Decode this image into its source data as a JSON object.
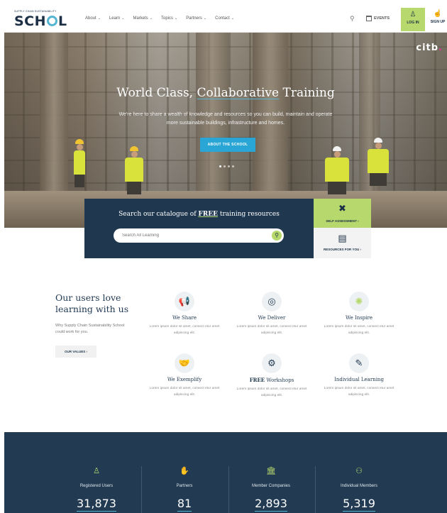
{
  "nav": {
    "logo_tagline": "SUPPLY CHAIN SUSTAINABILITY",
    "logo_text": "SCH",
    "logo_text_end": "L",
    "menu": [
      {
        "label": "About"
      },
      {
        "label": "Learn"
      },
      {
        "label": "Markets"
      },
      {
        "label": "Topics"
      },
      {
        "label": "Partners"
      },
      {
        "label": "Contact"
      }
    ],
    "search_icon": "search-icon",
    "events_label": "EVENTS",
    "login_label": "LOG IN",
    "signup_label": "SIGN UP"
  },
  "hero": {
    "partner_logo": "citb",
    "title_part1": "World Class, ",
    "title_underlined": "Collaborative",
    "title_part2": " Training",
    "subtitle": "We're here to share a wealth of knowledge and resources so you can build, maintain and operate more sustainable buildings, infrastructure and homes.",
    "cta_label": "ABOUT THE SCHOOL",
    "slides": 4,
    "active_slide": 1
  },
  "search": {
    "title_part1": "Search our catalogue of ",
    "title_highlight": "FREE",
    "title_part2": " training resources",
    "placeholder": "Search All Learning",
    "self_assessment_label": "SELF ASSESSMENT  ›",
    "resources_label": "RESOURCES FOR YOU  ›"
  },
  "users_love": {
    "title": "Our users love learning with us",
    "text": "Why Supply Chain Sustainability School could work for you.",
    "button_label": "OUR VALUES  ›",
    "features": [
      {
        "icon": "megaphone-icon",
        "title": "We Share",
        "text": "Lorem ipsum dolor sit amet, consect etur amet adipiscing elit."
      },
      {
        "icon": "target-icon",
        "title": "We Deliver",
        "text": "Lorem ipsum dolor sit amet, consect etur amet adipiscing elit."
      },
      {
        "icon": "lightbulb-icon",
        "title": "We Inspire",
        "text": "Lorem ipsum dolor sit amet, consect etur amet adipiscing elit."
      },
      {
        "icon": "handshake-icon",
        "title": "We Exemplify",
        "text": "Lorem ipsum dolor sit amet, consect etur amet adipiscing elit."
      },
      {
        "icon": "workshop-icon",
        "title_bold": "FREE",
        "title": " Workshops",
        "text": "Lorem ipsum dolor sit amet, consect etur amet adipiscing elit."
      },
      {
        "icon": "learning-icon",
        "title": "Individual Learning",
        "text": "Lorem ipsum dolor sit amet, consect etur amet adipiscing elit."
      }
    ]
  },
  "stats": [
    {
      "icon": "user-icon",
      "label": "Registered Users",
      "value": "31,873"
    },
    {
      "icon": "handshake-icon",
      "label": "Partners",
      "value": "81"
    },
    {
      "icon": "building-icon",
      "label": "Member Companies",
      "value": "2,893"
    },
    {
      "icon": "users-icon",
      "label": "Individual Members",
      "value": "5,319"
    }
  ],
  "colors": {
    "navy": "#1f3850",
    "lime": "#b6d86c",
    "accent_blue": "#2aa6d6"
  }
}
